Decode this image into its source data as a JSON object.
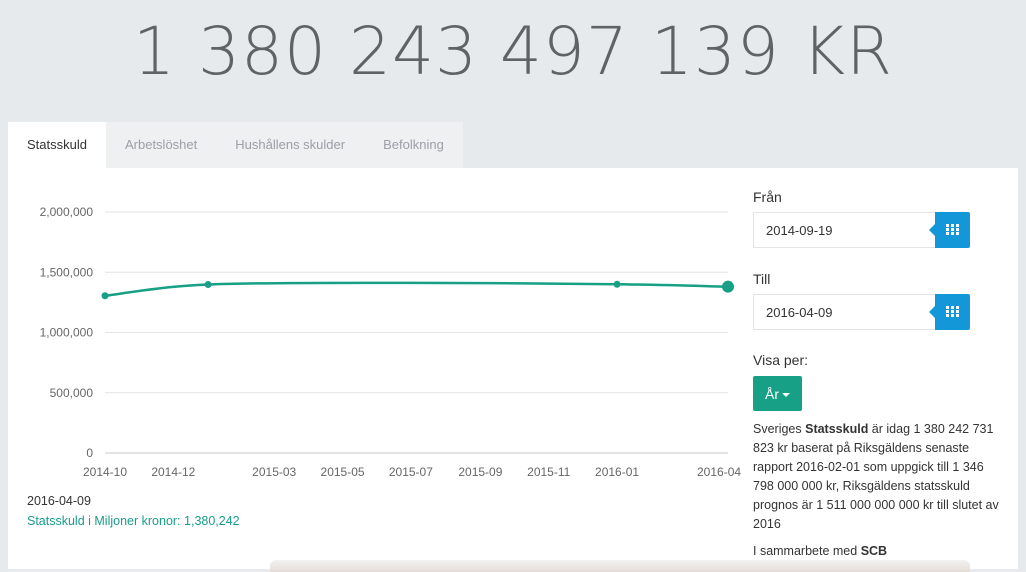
{
  "counter": {
    "value": "1 380 243 497 139 KR"
  },
  "tabs": [
    {
      "label": "Statsskuld",
      "active": true
    },
    {
      "label": "Arbetslöshet",
      "active": false
    },
    {
      "label": "Hushållens skulder",
      "active": false
    },
    {
      "label": "Befolkning",
      "active": false
    }
  ],
  "side": {
    "from_label": "Från",
    "from_value": "2014-09-19",
    "to_label": "Till",
    "to_value": "2016-04-09",
    "visa_label": "Visa per:",
    "visa_button": "År",
    "info": {
      "pre": "Sveriges ",
      "bold": "Statsskuld",
      "post": " är idag 1 380 242 731 823 kr baserat på Riksgäldens senaste rapport 2016-02-01 som uppgick till 1 346 798 000 000 kr, Riksgäldens statsskuld prognos är 1 511 000 000 000 kr till slutet av 2016"
    },
    "partner_pre": "I sammarbete med ",
    "partner_bold": "SCB"
  },
  "tooltip": {
    "date": "2016-04-09",
    "series_label": "Statsskuld i Miljoner kronor:",
    "value": "1,380,242"
  },
  "colors": {
    "line": "#17a085",
    "accent_blue": "#1497d8",
    "accent_green": "#17a085"
  },
  "chart_data": {
    "type": "line",
    "x_tick_labels": [
      "2014-10",
      "2014-12",
      "2015-03",
      "2015-05",
      "2015-07",
      "2015-09",
      "2015-11",
      "2016-01",
      "2016-04"
    ],
    "y_tick_labels": [
      "2,000,000",
      "1,500,000",
      "1,000,000",
      "500,000",
      "0"
    ],
    "ylim": [
      0,
      2000000
    ],
    "grid": true,
    "series": [
      {
        "x": [
          "2014-10",
          "2015-01",
          "2015-07",
          "2016-01",
          "2016-04-09"
        ],
        "values": [
          1305000,
          1398000,
          1412000,
          1400000,
          1380242
        ]
      }
    ]
  }
}
